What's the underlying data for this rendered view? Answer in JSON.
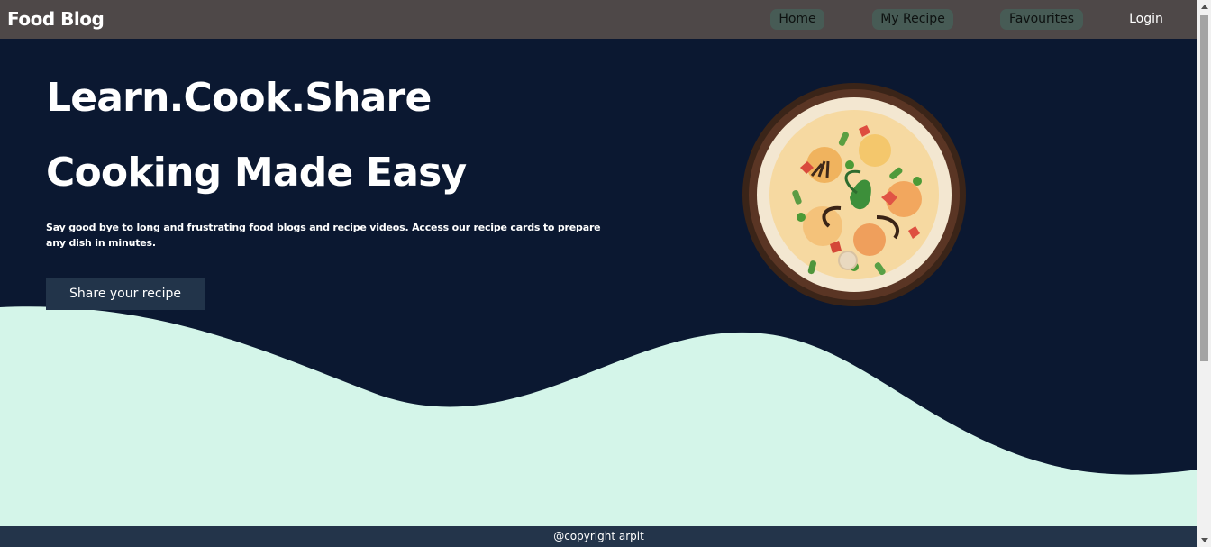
{
  "navbar": {
    "brand": "Food Blog",
    "items": [
      {
        "label": "Home"
      },
      {
        "label": "My Recipe"
      },
      {
        "label": "Favourites"
      },
      {
        "label": "Login"
      }
    ]
  },
  "hero": {
    "headline_1": "Learn.Cook.Share",
    "headline_2": "Cooking Made Easy",
    "tagline": "Say good bye to long and frustrating food blogs and recipe videos. Access our recipe cards to prepare any dish in minutes.",
    "cta_label": "Share your recipe",
    "image_icon": "biryani-bowl-icon"
  },
  "footer": {
    "copyright": "@copyright arpit"
  },
  "colors": {
    "navbar": "#4e4848",
    "hero_background": "#0b1831",
    "wave": "#d4f5e9",
    "nav_pill": "#475b55",
    "cta": "#22344a",
    "footer": "#23344a"
  }
}
